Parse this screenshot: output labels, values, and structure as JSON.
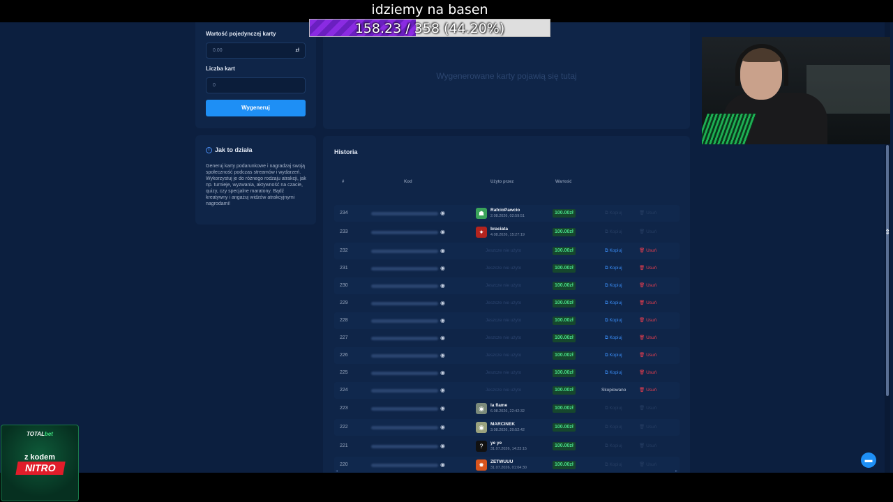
{
  "overlay": {
    "goal_title": "idziemy na basen",
    "goal_text": "158.23 / 358 (44.20%)",
    "goal_progress": 0.442
  },
  "generator": {
    "single_value_label": "Wartość pojedynczej karty",
    "single_value_placeholder": "0.00",
    "currency": "zł",
    "count_label": "Liczba kart",
    "count_placeholder": "0",
    "generate_button": "Wygeneruj"
  },
  "how_it_works": {
    "title": "Jak to działa",
    "text": "Generuj karty podarunkowe i nagradzaj swoją społeczność podczas streamów i wydarzeń. Wykorzystuj je do różnego rodzaju atrakcji, jak np. turnieje, wyzwania, aktywność na czacie, quizy, czy specjalne maratony. Bądź kreatywny i angażuj widzów atrakcyjnymi nagrodami!"
  },
  "generated": {
    "placeholder": "Wygenerowane karty pojawią się tutaj"
  },
  "history": {
    "title": "Historia",
    "columns": {
      "num": "#",
      "code": "Kod",
      "used_by": "Użyto przez",
      "value": "Wartość"
    },
    "copy_label": "Kopiuj",
    "delete_label": "Usuń",
    "unused_label": "Jeszcze nie użyto",
    "copied_label": "Skopiowano",
    "rows": [
      {
        "num": "234",
        "user": "RafcioPawcio",
        "date": "2.08.2026, 02:59:51",
        "value": "100.00zł",
        "state": "used",
        "avatar": "avatar-green"
      },
      {
        "num": "233",
        "user": "braciata",
        "date": "4.08.2026, 15:27:19",
        "value": "100.00zł",
        "state": "used",
        "avatar": "avatar-red"
      },
      {
        "num": "232",
        "user": "",
        "date": "",
        "value": "100.00zł",
        "state": "unused",
        "avatar": ""
      },
      {
        "num": "231",
        "user": "",
        "date": "",
        "value": "100.00zł",
        "state": "unused",
        "avatar": ""
      },
      {
        "num": "230",
        "user": "",
        "date": "",
        "value": "100.00zł",
        "state": "unused",
        "avatar": ""
      },
      {
        "num": "229",
        "user": "",
        "date": "",
        "value": "100.00zł",
        "state": "unused",
        "avatar": ""
      },
      {
        "num": "228",
        "user": "",
        "date": "",
        "value": "100.00zł",
        "state": "unused",
        "avatar": ""
      },
      {
        "num": "227",
        "user": "",
        "date": "",
        "value": "100.00zł",
        "state": "unused",
        "avatar": ""
      },
      {
        "num": "226",
        "user": "",
        "date": "",
        "value": "100.00zł",
        "state": "unused",
        "avatar": ""
      },
      {
        "num": "225",
        "user": "",
        "date": "",
        "value": "100.00zł",
        "state": "unused",
        "avatar": ""
      },
      {
        "num": "224",
        "user": "",
        "date": "",
        "value": "100.00zł",
        "state": "copied",
        "avatar": ""
      },
      {
        "num": "223",
        "user": "la flame",
        "date": "6.08.2026, 22:42:32",
        "value": "100.00zł",
        "state": "used",
        "avatar": "avatar-photo"
      },
      {
        "num": "222",
        "user": "MARCINEK",
        "date": "3.08.2026, 20:52:42",
        "value": "100.00zł",
        "state": "used",
        "avatar": "avatar-photo2"
      },
      {
        "num": "221",
        "user": "ye ye",
        "date": "31.07.2026, 14:23:15",
        "value": "100.00zł",
        "state": "used",
        "avatar": "avatar-question"
      },
      {
        "num": "220",
        "user": "ZETWUUU",
        "date": "31.07.2026, 01:04:30",
        "value": "100.00zł",
        "state": "used",
        "avatar": "avatar-orange"
      }
    ]
  },
  "promo": {
    "brand_a": "TOTAL",
    "brand_b": "bet",
    "line": "z kodem",
    "code": "NITRO"
  },
  "colors": {
    "background": "#0c1f3f",
    "panel": "#0f2548",
    "accent": "#1e8ff5",
    "value_green": "#48e08a",
    "delete_red": "#ef3e4f",
    "goal_purple": "#8a2be2"
  }
}
